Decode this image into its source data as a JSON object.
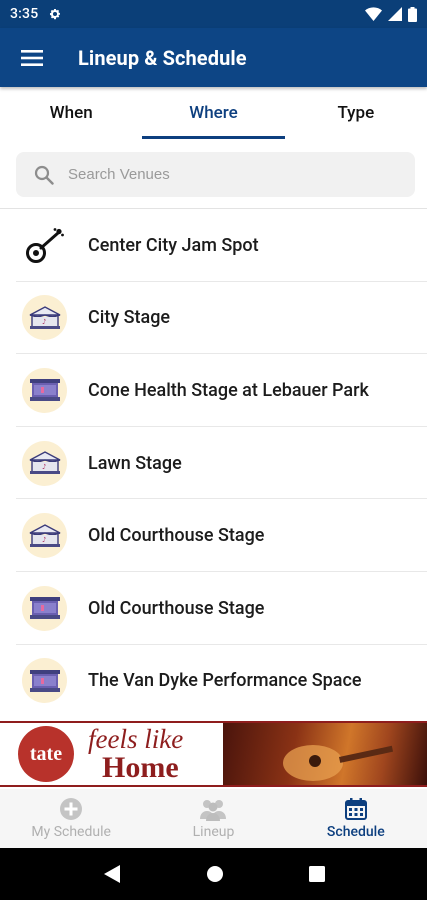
{
  "status_bar": {
    "time": "3:35"
  },
  "app_bar": {
    "title": "Lineup & Schedule"
  },
  "tabs": [
    {
      "label": "When",
      "active": false
    },
    {
      "label": "Where",
      "active": true
    },
    {
      "label": "Type",
      "active": false
    }
  ],
  "search": {
    "placeholder": "Search Venues",
    "value": ""
  },
  "venues": [
    {
      "name": "Center City Jam Spot",
      "icon": "banjo-icon"
    },
    {
      "name": "City Stage",
      "icon": "tent-stage-icon"
    },
    {
      "name": "Cone Health Stage at Lebauer Park",
      "icon": "screen-stage-icon"
    },
    {
      "name": "Lawn Stage",
      "icon": "tent-stage-icon"
    },
    {
      "name": "Old Courthouse Stage",
      "icon": "tent-stage-icon"
    },
    {
      "name": "Old Courthouse Stage",
      "icon": "screen-stage-icon"
    },
    {
      "name": "The Van Dyke Performance Space",
      "icon": "screen-stage-icon"
    }
  ],
  "ad": {
    "logo_text": "tate",
    "line1": "feels like",
    "line2": "Home"
  },
  "bottom_nav": [
    {
      "label": "My Schedule",
      "icon": "add-circle-icon",
      "active": false
    },
    {
      "label": "Lineup",
      "icon": "people-icon",
      "active": false
    },
    {
      "label": "Schedule",
      "icon": "calendar-icon",
      "active": true
    }
  ],
  "colors": {
    "primary": "#0d4585",
    "accent": "#0d3f7f",
    "venue_icon_bg": "#fbefd2",
    "ad_red": "#8e1e1e"
  }
}
